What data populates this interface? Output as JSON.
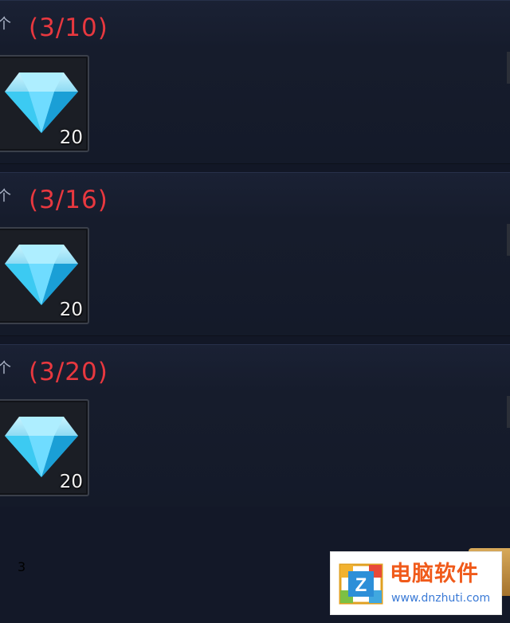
{
  "colors": {
    "background": "#121726",
    "progress_text": "#e8383f",
    "quantity_text": "#f2f2f2",
    "watermark_title": "#f05a1a",
    "watermark_url": "#3a7ad6"
  },
  "achievements": [
    {
      "progress": "(3/10)",
      "reward": {
        "icon": "diamond-icon",
        "quantity": "20"
      }
    },
    {
      "progress": "(3/16)",
      "reward": {
        "icon": "diamond-icon",
        "quantity": "20"
      }
    },
    {
      "progress": "(3/20)",
      "reward": {
        "icon": "diamond-icon",
        "quantity": "20"
      }
    }
  ],
  "footer": {
    "count": "3"
  },
  "watermark": {
    "title": "电脑软件",
    "url": "www.dnzhuti.com",
    "logo_letter": "Z"
  }
}
